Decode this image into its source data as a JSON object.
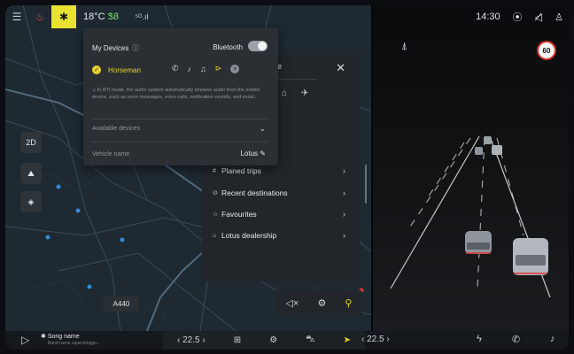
{
  "status": {
    "temperature": "18°C",
    "eco_indicator": "ᏕᏰ",
    "signal": "⁵ᴳ.ıl",
    "time": "14:30",
    "icons": [
      "settings-sliders-icon",
      "seat-heat-icon",
      "bluetooth-icon",
      "signal-icon",
      "cast-icon",
      "mute-icon",
      "user-icon"
    ]
  },
  "devices": {
    "title": "My Devices",
    "bluetooth_label": "Bluetooth",
    "bluetooth_on": true,
    "device_name": "Horseman",
    "note": "In RTI mode, the audio system automatically streams audio from the mobile device, such as voice messages, voice calls, notification sounds, and music.",
    "available_label": "Available devices",
    "vehicle_name_label": "Vehicle name",
    "vehicle_name_value": "Lotus"
  },
  "nav": {
    "items": [
      "Planed trips",
      "Recent destinations",
      "Favourites",
      "Lotus dealership"
    ],
    "search_fragment": "e"
  },
  "map": {
    "mode_label": "2D",
    "road_label": "A440"
  },
  "adas": {
    "speed_limit": "60"
  },
  "bottom": {
    "song_name": "Song name",
    "artist_name": "Band name supertonggu...",
    "left_temp": "22.5",
    "right_temp": "22.5"
  },
  "colors": {
    "accent": "#e8e331",
    "panel": "#2b2f33",
    "map_bg": "#1e2932"
  }
}
